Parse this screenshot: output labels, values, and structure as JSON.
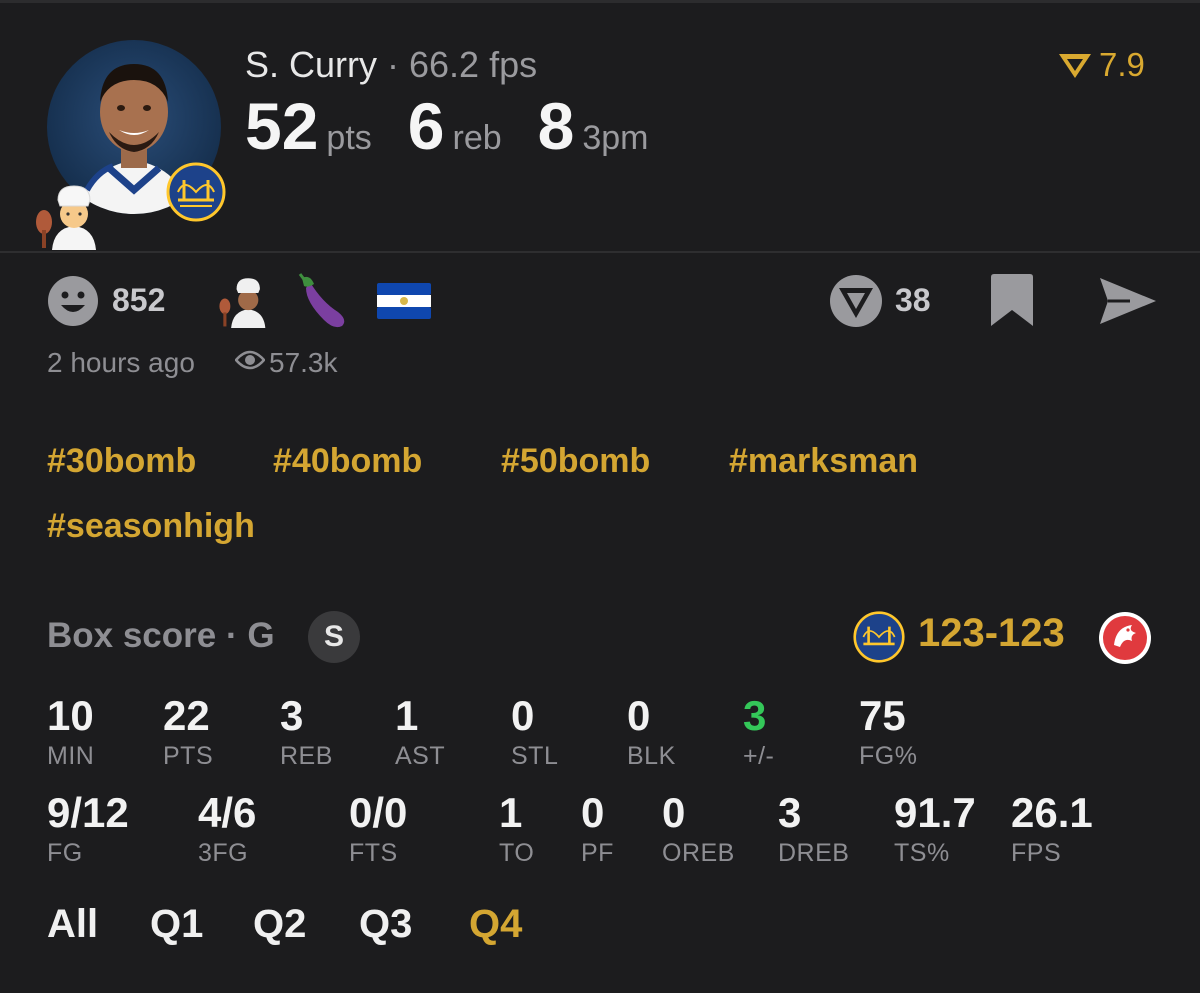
{
  "header": {
    "player_name": "S. Curry",
    "separator": " · ",
    "fps": "66.2 fps",
    "rating": "7.9",
    "stats": [
      {
        "value": "52",
        "unit": "pts"
      },
      {
        "value": "6",
        "unit": "reb"
      },
      {
        "value": "8",
        "unit": "3pm"
      }
    ]
  },
  "reactions": {
    "smiley_count": "852",
    "vcoin_count": "38",
    "time_ago": "2 hours ago",
    "views": "57.3k"
  },
  "hashtags": [
    "#30bomb",
    "#40bomb",
    "#50bomb",
    "#marksman",
    "#seasonhigh"
  ],
  "box_score": {
    "title": "Box score · G",
    "badge": "S",
    "score": "123-123",
    "row1": [
      {
        "value": "10",
        "label": "MIN"
      },
      {
        "value": "22",
        "label": "PTS"
      },
      {
        "value": "3",
        "label": "REB"
      },
      {
        "value": "1",
        "label": "AST"
      },
      {
        "value": "0",
        "label": "STL"
      },
      {
        "value": "0",
        "label": "BLK"
      },
      {
        "value": "3",
        "label": "+/-"
      },
      {
        "value": "75",
        "label": "FG%"
      }
    ],
    "row2": [
      {
        "value": "9/12",
        "label": "FG"
      },
      {
        "value": "4/6",
        "label": "3FG"
      },
      {
        "value": "0/0",
        "label": "FTS"
      },
      {
        "value": "1",
        "label": "TO"
      },
      {
        "value": "0",
        "label": "PF"
      },
      {
        "value": "0",
        "label": "OREB"
      },
      {
        "value": "3",
        "label": "DREB"
      },
      {
        "value": "91.7",
        "label": "TS%"
      },
      {
        "value": "26.1",
        "label": "FPS"
      }
    ]
  },
  "quarter_tabs": [
    "All",
    "Q1",
    "Q2",
    "Q3",
    "Q4"
  ],
  "active_tab": "Q4",
  "colors": {
    "accent": "#d4a632",
    "positive": "#34c759",
    "background": "#1c1c1e"
  }
}
